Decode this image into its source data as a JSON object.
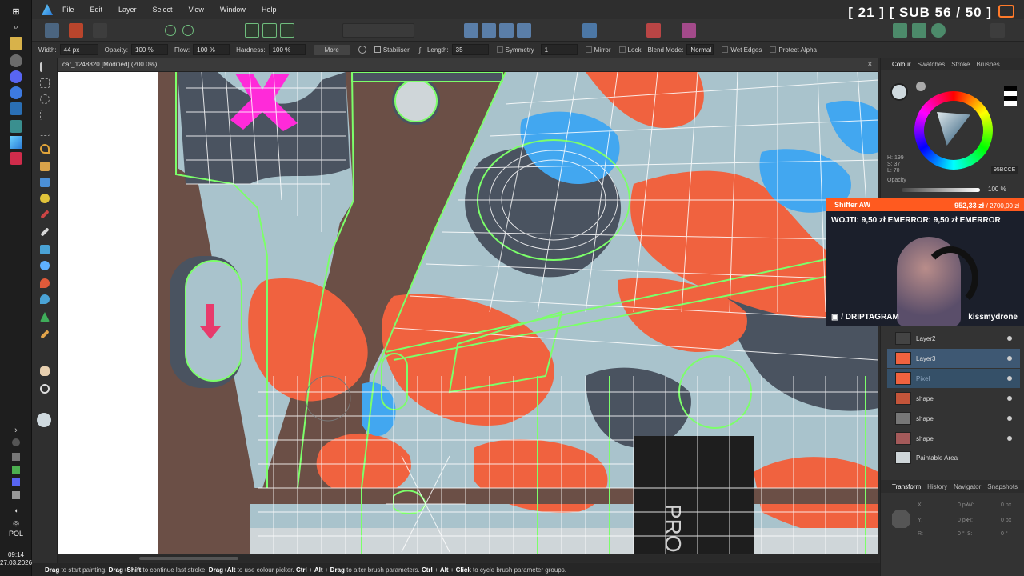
{
  "menubar": {
    "items": [
      "File",
      "Edit",
      "Layer",
      "Select",
      "View",
      "Window",
      "Help"
    ],
    "stream_counter": "[ 21 ]   [ SUB 56 / 50 ]"
  },
  "context_toolbar": {
    "width_label": "Width:",
    "width_value": "44 px",
    "opacity_label": "Opacity:",
    "opacity_value": "100 %",
    "flow_label": "Flow:",
    "flow_value": "100 %",
    "hardness_label": "Hardness:",
    "hardness_value": "100 %",
    "more_label": "More",
    "stabiliser_label": "Stabiliser",
    "length_label": "Length:",
    "length_value": "35",
    "symmetry_label": "Symmetry",
    "symmetry_value": "1",
    "mirror_label": "Mirror",
    "lock_label": "Lock",
    "blend_mode_label": "Blend Mode:",
    "blend_mode_value": "Normal",
    "wet_edges_label": "Wet Edges",
    "protect_alpha_label": "Protect Alpha"
  },
  "document": {
    "tab_title": "car_1248820 [Modified] (200.0%)",
    "close_glyph": "×"
  },
  "status_bar": {
    "parts": [
      {
        "b": "Drag",
        "t": " to start painting. "
      },
      {
        "b": "Drag",
        "t": "+"
      },
      {
        "b": "Shift",
        "t": " to continue last stroke. "
      },
      {
        "b": "Drag",
        "t": "+"
      },
      {
        "b": "Alt",
        "t": " to use colour picker. "
      },
      {
        "b": "Ctrl",
        "t": " + "
      },
      {
        "b": "Alt",
        "t": " + "
      },
      {
        "b": "Drag",
        "t": " to alter brush parameters. "
      },
      {
        "b": "Ctrl",
        "t": " + "
      },
      {
        "b": "Alt",
        "t": " + "
      },
      {
        "b": "Click",
        "t": " to cycle brush parameter groups."
      }
    ]
  },
  "right_panel": {
    "tabs_top": [
      "Colour",
      "Swatches",
      "Stroke",
      "Brushes"
    ],
    "hsl": {
      "h": "H: 199",
      "s": "S: 37",
      "l": "L: 70"
    },
    "hex": "95BCCE",
    "opacity_label": "Opacity",
    "opacity_value": "100 %",
    "layers": [
      {
        "name": "Layer2",
        "selected": false
      },
      {
        "name": "Layer3",
        "selected": true
      },
      {
        "name": "Pixel",
        "selected": true
      },
      {
        "name": "shape",
        "selected": false
      },
      {
        "name": "shape",
        "selected": false
      },
      {
        "name": "shape",
        "selected": false
      },
      {
        "name": "Paintable Area",
        "selected": false
      }
    ],
    "tabs_bottom": [
      "Transform",
      "History",
      "Navigator",
      "Snapshots"
    ],
    "transform": {
      "x": "X:",
      "x_val": "0 px",
      "y": "Y:",
      "y_val": "0 px",
      "w": "W:",
      "w_val": "0 px",
      "h": "H:",
      "h_val": "0 px",
      "r": "R:",
      "r_val": "0 °",
      "s": "S:",
      "s_val": "0 °"
    }
  },
  "webcam": {
    "header": "Shifter AW",
    "amount": "952,33 zł",
    "amount_total": "/ 2700,00 zł",
    "ticker": "WOJTI: 9,50 zł    EMERROR: 9,50 zł    EMERROR",
    "social_left": "/ DRIPTAGRAM",
    "social_right": "kissmydrone"
  },
  "taskbar": {
    "lang": "POL",
    "time": "09:14",
    "date": "27.03.2026"
  },
  "colors": {
    "camo_grey": "#a9c3cc",
    "camo_orange": "#f0623f",
    "camo_dark": "#4a5360",
    "camo_blue": "#42a7f0",
    "wire_green": "#7cff6a",
    "accent_orange": "#ff5a1f"
  }
}
